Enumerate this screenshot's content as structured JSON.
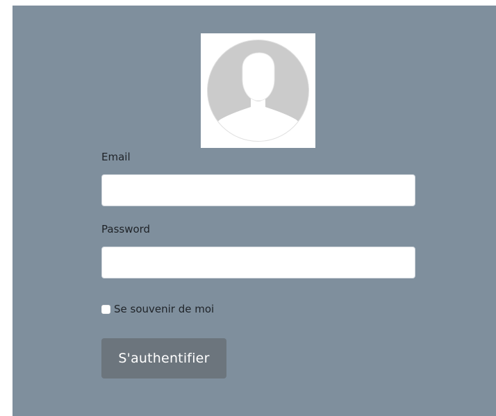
{
  "avatar": {
    "icon": "user-silhouette-icon"
  },
  "form": {
    "email_label": "Email",
    "email_value": "",
    "password_label": "Password",
    "password_value": "",
    "remember_label": "Se souvenir de moi",
    "remember_checked": false,
    "submit_label": "S'authentifier"
  },
  "colors": {
    "panel_background": "#7f8f9d",
    "button_background": "#6c757d",
    "avatar_circle": "#cbcbcb"
  }
}
